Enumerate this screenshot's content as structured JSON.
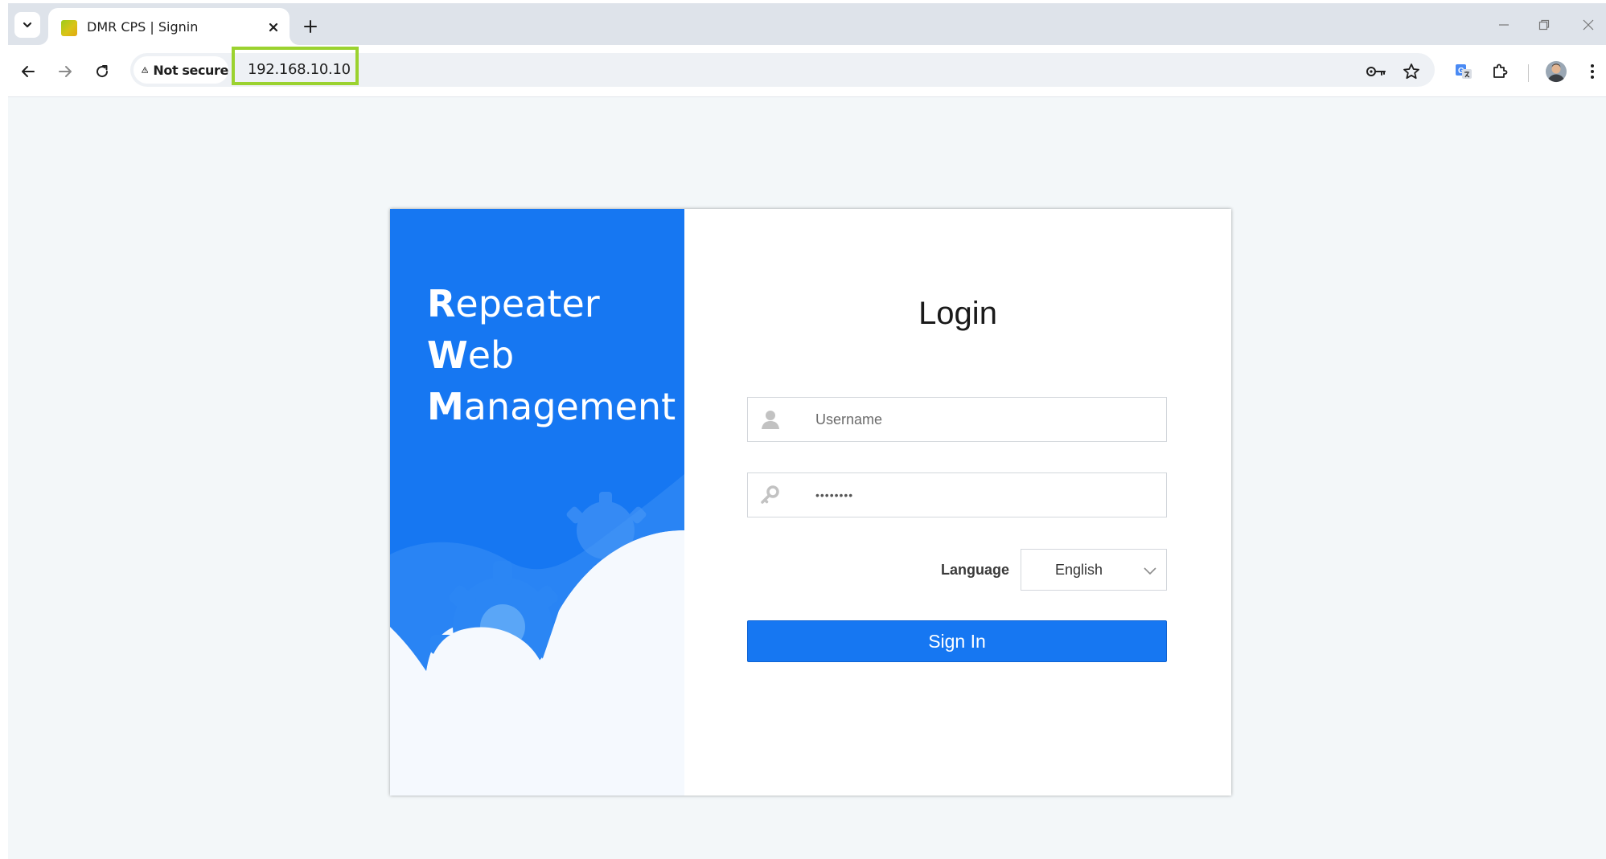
{
  "browser": {
    "tab": {
      "title": "DMR CPS | Signin"
    },
    "security_chip": "Not secure",
    "url": "192.168.10.10",
    "icons": {
      "tab_list": "chevron-down-icon",
      "close_tab": "close-icon",
      "new_tab": "plus-icon",
      "back": "back-arrow-icon",
      "forward": "forward-arrow-icon",
      "reload": "reload-icon",
      "warning": "warning-triangle-icon",
      "password_key": "key-icon",
      "bookmark": "star-icon",
      "translate": "translate-icon",
      "extensions": "puzzle-icon",
      "profile": "avatar",
      "menu": "kebab-menu-icon"
    },
    "url_highlight_color": "#9bd22f"
  },
  "branding": {
    "line1_initial": "R",
    "line1_rest": "epeater",
    "line2_initial": "W",
    "line2_rest": "eb",
    "line3_initial": "M",
    "line3_rest": "anagement",
    "panel_color": "#1677f2"
  },
  "login": {
    "title": "Login",
    "username_placeholder": "Username",
    "password_mask": "••••••••",
    "language_label": "Language",
    "language_value": "English",
    "signin_label": "Sign In",
    "accent_color": "#1677f2"
  }
}
